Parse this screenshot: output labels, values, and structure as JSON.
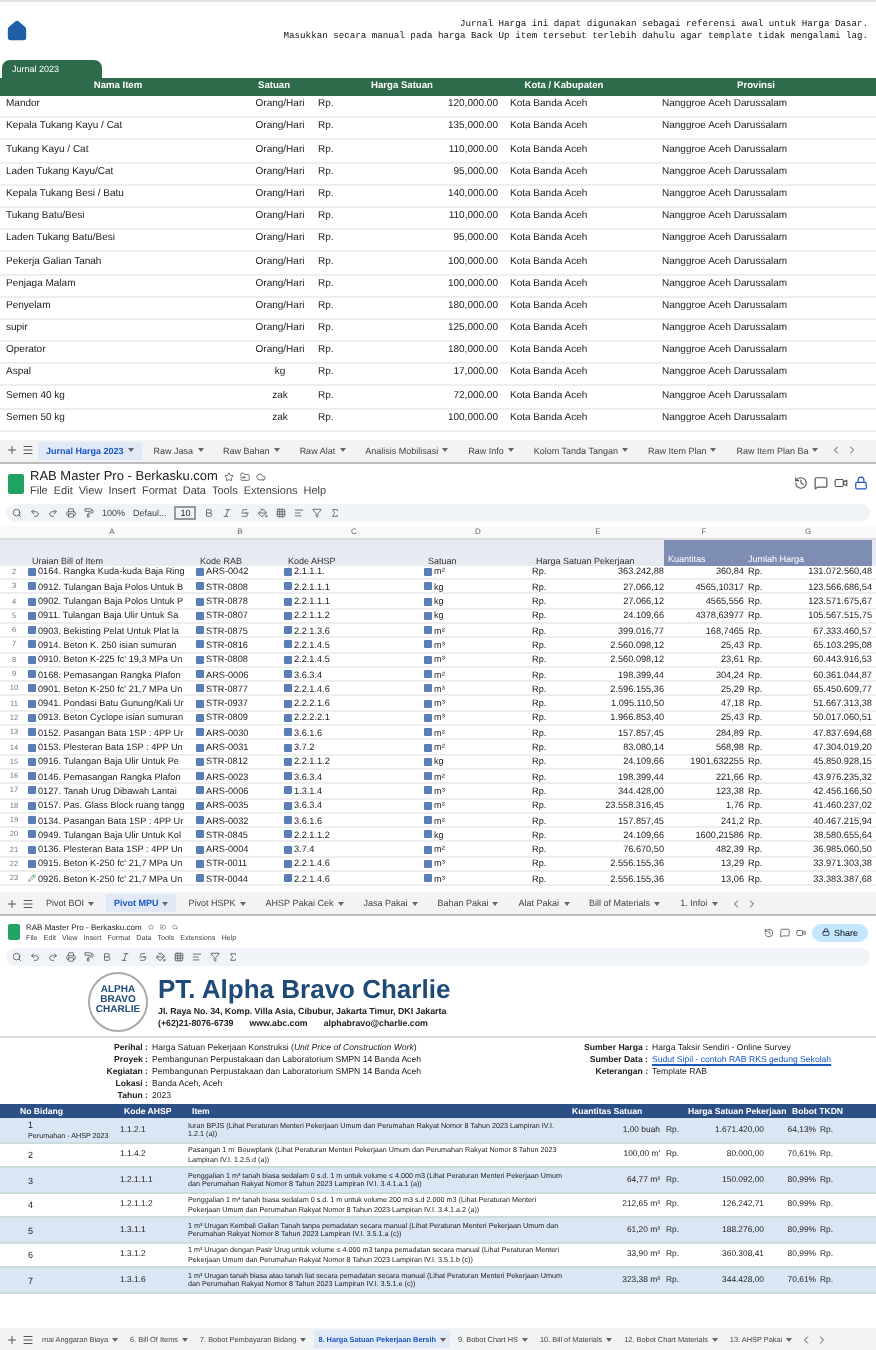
{
  "journal": {
    "notes": [
      "Jurnal Harga ini dapat digunakan sebagai referensi awal untuk Harga Dasar.",
      "Masukkan secara manual pada harga Back Up item tersebut terlebih dahulu agar template tidak mengalami lag."
    ],
    "filter_tab": "Jurnal 2023",
    "columns": [
      "Nama Item",
      "Satuan",
      "Harga Satuan",
      "Kota / Kabupaten",
      "Provinsi"
    ],
    "rows": [
      {
        "name": "Mandor",
        "unit": "Orang/Hari",
        "currency": "Rp.",
        "price": "120,000.00",
        "city": "Kota Banda Aceh",
        "province": "Nanggroe Aceh Darussalam"
      },
      {
        "name": "Kepala Tukang Kayu / Cat",
        "unit": "Orang/Hari",
        "currency": "Rp.",
        "price": "135,000.00",
        "city": "Kota Banda Aceh",
        "province": "Nanggroe Aceh Darussalam"
      },
      {
        "name": "Tukang Kayu / Cat",
        "unit": "Orang/Hari",
        "currency": "Rp.",
        "price": "110,000.00",
        "city": "Kota Banda Aceh",
        "province": "Nanggroe Aceh Darussalam"
      },
      {
        "name": "Laden Tukang Kayu/Cat",
        "unit": "Orang/Hari",
        "currency": "Rp.",
        "price": "95,000.00",
        "city": "Kota Banda Aceh",
        "province": "Nanggroe Aceh Darussalam"
      },
      {
        "name": "Kepala Tukang Besi / Batu",
        "unit": "Orang/Hari",
        "currency": "Rp.",
        "price": "140,000.00",
        "city": "Kota Banda Aceh",
        "province": "Nanggroe Aceh Darussalam"
      },
      {
        "name": "Tukang Batu/Besi",
        "unit": "Orang/Hari",
        "currency": "Rp.",
        "price": "110,000.00",
        "city": "Kota Banda Aceh",
        "province": "Nanggroe Aceh Darussalam"
      },
      {
        "name": "Laden Tukang Batu/Besi",
        "unit": "Orang/Hari",
        "currency": "Rp.",
        "price": "95,000.00",
        "city": "Kota Banda Aceh",
        "province": "Nanggroe Aceh Darussalam"
      },
      {
        "name": "Pekerja Galian Tanah",
        "unit": "Orang/Hari",
        "currency": "Rp.",
        "price": "100,000.00",
        "city": "Kota Banda Aceh",
        "province": "Nanggroe Aceh Darussalam"
      },
      {
        "name": "Penjaga Malam",
        "unit": "Orang/Hari",
        "currency": "Rp.",
        "price": "100,000.00",
        "city": "Kota Banda Aceh",
        "province": "Nanggroe Aceh Darussalam"
      },
      {
        "name": "Penyelam",
        "unit": "Orang/Hari",
        "currency": "Rp.",
        "price": "180,000.00",
        "city": "Kota Banda Aceh",
        "province": "Nanggroe Aceh Darussalam"
      },
      {
        "name": "supir",
        "unit": "Orang/Hari",
        "currency": "Rp.",
        "price": "125,000.00",
        "city": "Kota Banda Aceh",
        "province": "Nanggroe Aceh Darussalam"
      },
      {
        "name": "Operator",
        "unit": "Orang/Hari",
        "currency": "Rp.",
        "price": "180,000.00",
        "city": "Kota Banda Aceh",
        "province": "Nanggroe Aceh Darussalam"
      },
      {
        "name": "Aspal",
        "unit": "kg",
        "currency": "Rp.",
        "price": "17,000.00",
        "city": "Kota Banda Aceh",
        "province": "Nanggroe Aceh Darussalam"
      },
      {
        "name": "Semen 40 kg",
        "unit": "zak",
        "currency": "Rp.",
        "price": "72,000.00",
        "city": "Kota Banda Aceh",
        "province": "Nanggroe Aceh Darussalam"
      },
      {
        "name": "Semen 50 kg",
        "unit": "zak",
        "currency": "Rp.",
        "price": "100,000.00",
        "city": "Kota Banda Aceh",
        "province": "Nanggroe Aceh Darussalam"
      }
    ],
    "sheet_tabs": [
      {
        "label": "Jurnal Harga 2023",
        "selected": true
      },
      {
        "label": "Raw Jasa",
        "selected": false
      },
      {
        "label": "Raw Bahan",
        "selected": false
      },
      {
        "label": "Raw Alat",
        "selected": false
      },
      {
        "label": "Analisis Mobilisasi",
        "selected": false
      },
      {
        "label": "Raw Info",
        "selected": false
      },
      {
        "label": "Kolom Tanda Tangan",
        "selected": false
      },
      {
        "label": "Raw Item Plan",
        "selected": false
      },
      {
        "label": "Raw Item Plan Ba",
        "selected": false
      }
    ]
  },
  "bill": {
    "title": "RAB Master Pro - Berkasku.com",
    "menu": [
      "File",
      "Edit",
      "View",
      "Insert",
      "Format",
      "Data",
      "Tools",
      "Extensions",
      "Help"
    ],
    "zoom": "100%",
    "font": "Defaul...",
    "font_size": "10",
    "column_letters": [
      "A",
      "B",
      "C",
      "D",
      "E",
      "F",
      "G"
    ],
    "columns": [
      "Uraian Bill of Item",
      "Kode RAB",
      "Kode AHSP",
      "Satuan",
      "Harga Satuan Pekerjaan",
      "Kuantitas",
      "Jumlah Harga"
    ],
    "rows": [
      {
        "n": "2",
        "item": "0164. Rangka Kuda-kuda Baja Ring",
        "rab": "ARS-0042",
        "ahsp": "2.1.1.1.",
        "unit": "m²",
        "rp": "Rp.",
        "price": "363.242,88",
        "qty": "360,84",
        "rp2": "Rp.",
        "total": "131.072.560,48"
      },
      {
        "n": "3",
        "item": "0912. Tulangan Baja Polos Untuk B",
        "rab": "STR-0808",
        "ahsp": "2.2.1.1.1",
        "unit": "kg",
        "rp": "Rp.",
        "price": "27.066,12",
        "qty": "4565,10317",
        "rp2": "Rp.",
        "total": "123.566.686,54"
      },
      {
        "n": "4",
        "item": "0902. Tulangan Baja Polos Untuk P",
        "rab": "STR-0878",
        "ahsp": "2.2.1.1.1",
        "unit": "kg",
        "rp": "Rp.",
        "price": "27.066,12",
        "qty": "4565,556",
        "rp2": "Rp.",
        "total": "123.571.675,67"
      },
      {
        "n": "5",
        "item": "0911. Tulangan Baja Ulir Untuk Sa",
        "rab": "STR-0807",
        "ahsp": "2.2.1.1.2",
        "unit": "kg",
        "rp": "Rp.",
        "price": "24.109,66",
        "qty": "4378,63977",
        "rp2": "Rp.",
        "total": "105.567.515,75"
      },
      {
        "n": "6",
        "item": "0903. Bekisting Pelat Untuk Plat la",
        "rab": "STR-0875",
        "ahsp": "2.2.1.3.6",
        "unit": "m²",
        "rp": "Rp.",
        "price": "399.016,77",
        "qty": "168,7465",
        "rp2": "Rp.",
        "total": "67.333.460,57"
      },
      {
        "n": "7",
        "item": "0914. Beton K. 250 isian sumuran",
        "rab": "STR-0816",
        "ahsp": "2.2.1.4.5",
        "unit": "m³",
        "rp": "Rp.",
        "price": "2.560.098,12",
        "qty": "25,43",
        "rp2": "Rp.",
        "total": "65.103.295,08"
      },
      {
        "n": "8",
        "item": "0910. Beton K-225 fc' 19,3 MPa Un",
        "rab": "STR-0808",
        "ahsp": "2.2.1.4.5",
        "unit": "m³",
        "rp": "Rp.",
        "price": "2.560.098,12",
        "qty": "23,61",
        "rp2": "Rp.",
        "total": "60.443.916,53"
      },
      {
        "n": "9",
        "item": "0168. Pemasangan Rangka Plafon",
        "rab": "ARS-0006",
        "ahsp": "3.6.3.4",
        "unit": "m²",
        "rp": "Rp.",
        "price": "198.399,44",
        "qty": "304,24",
        "rp2": "Rp.",
        "total": "60.361.044,87"
      },
      {
        "n": "10",
        "item": "0901. Beton K-250 fc' 21,7 MPa Un",
        "rab": "STR-0877",
        "ahsp": "2.2.1.4.6",
        "unit": "m³",
        "rp": "Rp.",
        "price": "2.596.155,36",
        "qty": "25,29",
        "rp2": "Rp.",
        "total": "65.450.609,77"
      },
      {
        "n": "11",
        "item": "0941. Pondasi Batu Gunung/Kali Ur",
        "rab": "STR-0937",
        "ahsp": "2.2.2.1.6",
        "unit": "m³",
        "rp": "Rp.",
        "price": "1.095.110,50",
        "qty": "47,18",
        "rp2": "Rp.",
        "total": "51.667.313,38"
      },
      {
        "n": "12",
        "item": "0913. Beton Cyclope isian sumuran",
        "rab": "STR-0809",
        "ahsp": "2.2.2.2.1",
        "unit": "m³",
        "rp": "Rp.",
        "price": "1.966.853,40",
        "qty": "25,43",
        "rp2": "Rp.",
        "total": "50.017.060,51"
      },
      {
        "n": "13",
        "item": "0152. Pasangan Bata 1SP : 4PP Ur",
        "rab": "ARS-0030",
        "ahsp": "3.6.1.6",
        "unit": "m²",
        "rp": "Rp.",
        "price": "157.857,45",
        "qty": "284,89",
        "rp2": "Rp.",
        "total": "47.837.694,68"
      },
      {
        "n": "14",
        "item": "0153. Plesteran Bata 1SP : 4PP Un",
        "rab": "ARS-0031",
        "ahsp": "3.7.2",
        "unit": "m²",
        "rp": "Rp.",
        "price": "83.080,14",
        "qty": "568,98",
        "rp2": "Rp.",
        "total": "47.304.019,20"
      },
      {
        "n": "15",
        "item": "0916. Tulangan Baja Ulir Untuk Pe",
        "rab": "STR-0812",
        "ahsp": "2.2.1.1.2",
        "unit": "kg",
        "rp": "Rp.",
        "price": "24.109,66",
        "qty": "1901,632255",
        "rp2": "Rp.",
        "total": "45.850.928,15"
      },
      {
        "n": "16",
        "item": "0146. Pemasangan Rangka Plafon",
        "rab": "ARS-0023",
        "ahsp": "3.6.3.4",
        "unit": "m²",
        "rp": "Rp.",
        "price": "198.399,44",
        "qty": "221,66",
        "rp2": "Rp.",
        "total": "43.976.235,32"
      },
      {
        "n": "17",
        "item": "0127. Tanah Urug Dibawah Lantai",
        "rab": "ARS-0006",
        "ahsp": "1.3.1.4",
        "unit": "m³",
        "rp": "Rp.",
        "price": "344.428,00",
        "qty": "123,38",
        "rp2": "Rp.",
        "total": "42.456.166,50"
      },
      {
        "n": "18",
        "item": "0157. Pas. Glass Block ruang tangg",
        "rab": "ARS-0035",
        "ahsp": "3.6.3.4",
        "unit": "m²",
        "rp": "Rp.",
        "price": "23.558.316,45",
        "qty": "1,76",
        "rp2": "Rp.",
        "total": "41.460.237,02"
      },
      {
        "n": "19",
        "item": "0134. Pasangan Bata 1SP : 4PP Ur",
        "rab": "ARS-0032",
        "ahsp": "3.6.1.6",
        "unit": "m²",
        "rp": "Rp.",
        "price": "157.857,45",
        "qty": "241,2",
        "rp2": "Rp.",
        "total": "40.467.215,94"
      },
      {
        "n": "20",
        "item": "0949. Tulangan Baja Ulir Untuk Kol",
        "rab": "STR-0845",
        "ahsp": "2.2.1.1.2",
        "unit": "kg",
        "rp": "Rp.",
        "price": "24.109,66",
        "qty": "1600,21586",
        "rp2": "Rp.",
        "total": "38.580.655,64"
      },
      {
        "n": "21",
        "item": "0136. Plesteran Bata 1SP : 4PP Un",
        "rab": "ARS-0004",
        "ahsp": "3.7.4",
        "unit": "m²",
        "rp": "Rp.",
        "price": "76.670,50",
        "qty": "482,39",
        "rp2": "Rp.",
        "total": "36.985.060,50"
      },
      {
        "n": "22",
        "item": "0915. Beton K-250 fc' 21,7 MPa Un",
        "rab": "STR-0011",
        "ahsp": "2.2.1.4.6",
        "unit": "m³",
        "rp": "Rp.",
        "price": "2.556.155,36",
        "qty": "13,29",
        "rp2": "Rp.",
        "total": "33.971.303,38"
      },
      {
        "n": "23",
        "item": "0926. Beton K-250 fc' 21,7 MPa Un",
        "rab": "STR-0044",
        "ahsp": "2.2.1.4.6",
        "unit": "m³",
        "rp": "Rp.",
        "price": "2.556.155,36",
        "qty": "13,06",
        "rp2": "Rp.",
        "total": "33.383.387,68"
      }
    ],
    "sheet_tabs": [
      {
        "label": "Pivot BOI",
        "selected": false
      },
      {
        "label": "Pivot MPU",
        "selected": true
      },
      {
        "label": "Pivot HSPK",
        "selected": false
      },
      {
        "label": "AHSP Pakai Cek",
        "selected": false
      },
      {
        "label": "Jasa Pakai",
        "selected": false
      },
      {
        "label": "Bahan Pakai",
        "selected": false
      },
      {
        "label": "Alat Pakai",
        "selected": false
      },
      {
        "label": "Bill of Materials",
        "selected": false
      },
      {
        "label": "1. Infoi",
        "selected": false
      }
    ]
  },
  "price_sheet": {
    "title": "RAB Master Pro - Berkasku.com",
    "menu": [
      "File",
      "Edit",
      "View",
      "Insert",
      "Format",
      "Data",
      "Tools",
      "Extensions",
      "Help"
    ],
    "share": "Share",
    "logo_lines": [
      "ALPHA",
      "BRAVO",
      "CHARLIE"
    ],
    "company": "PT. Alpha Bravo Charlie",
    "address": "Jl. Raya No. 34, Komp. Villa Asia, Cibubur, Jakarta Timur, DKI Jakarta",
    "contacts": [
      "(+62)21-8076-6739",
      "www.abc.com",
      "alphabravo@charlie.com"
    ],
    "info_left": [
      {
        "label": "Perihal :",
        "value": "Harga Satuan Pekerjaan Konstruksi (*Unit Price of Construction Work*)"
      },
      {
        "label": "Proyek :",
        "value": "Pembangunan Perpustakaan dan Laboratorium SMPN 14 Banda Aceh"
      },
      {
        "label": "Kegiatan :",
        "value": "Pembangunan Perpustakaan dan Laboratorium SMPN 14 Banda Aceh"
      },
      {
        "label": "Lokasi :",
        "value": "Banda Aceh, Aceh"
      },
      {
        "label": "Tahun :",
        "value": "2023"
      }
    ],
    "info_right": [
      {
        "label": "Sumber Harga :",
        "value": "Harga Taksir Sendiri - Online Survey",
        "kind": "text"
      },
      {
        "label": "Sumber Data :",
        "value": "Sudut Sipil - contoh RAB RKS gedung Sekolah",
        "kind": "link"
      },
      {
        "label": "Keterangan :",
        "value": "Template RAB",
        "kind": "text"
      }
    ],
    "columns": [
      "No Bidang",
      "Kode AHSP",
      "Item",
      "Kuantitas Satuan",
      "Harga Satuan Pekerjaan",
      "Bobot TKDN"
    ],
    "rows": [
      {
        "no": "1",
        "sub": "Perumahan - AHSP 2023",
        "code": "1.1.2.1",
        "item": "Iuran BPJS (Lihat Peraturan Menteri Pekerjaan Umum dan Perumahan Rakyat Nomor 8 Tahun 2023 Lampiran IV.I. 1.2.1 (a))",
        "qty": "1,00 buah",
        "rp": "Rp.",
        "price": "1.671.420,00",
        "tkdn": "64,13%",
        "rp2": "Rp."
      },
      {
        "no": "2",
        "code": "1.1.4.2",
        "item": "Pasangan 1 m' Bouwplank (Lihat Peraturan Menteri Pekerjaan Umum dan Perumahan Rakyat Nomor 8 Tahun 2023 Lampiran IV.I. 1.2.5.d (a))",
        "qty": "100,00 m'",
        "rp": "Rp.",
        "price": "80.000,00",
        "tkdn": "70,61%",
        "rp2": "Rp."
      },
      {
        "no": "3",
        "code": "1.2.1.1.1",
        "item": "Penggalian 1 m³ tanah biasa sedalam 0 s.d. 1 m untuk volume ≤ 4.000 m3 (Lihat Peraturan Menteri Pekerjaan Umum dan Perumahan Rakyat Nomor 8 Tahun 2023 Lampiran IV.I. 3.4.1.a.1 (a))",
        "qty": "64,77 m³",
        "rp": "Rp.",
        "price": "150.092,00",
        "tkdn": "80,99%",
        "rp2": "Rp."
      },
      {
        "no": "4",
        "code": "1.2.1.1.2",
        "item": "Penggalian 1 m³ tanah biasa sedalam 0 s.d. 1 m untuk volume 200 m3 s.d 2.000 m3 (Lihat Peraturan Menteri Pekerjaan Umum dan Perumahan Rakyat Nomor 8 Tahun 2023 Lampiran IV.I. 3.4.1.a.2 (a))",
        "qty": "212,65 m³",
        "rp": "Rp.",
        "price": "126.242,71",
        "tkdn": "80,99%",
        "rp2": "Rp."
      },
      {
        "no": "5",
        "code": "1.3.1.1",
        "item": "1 m³ Urugan Kembali Galian Tanah tanpa pemadatan secara manual (Lihat Peraturan Menteri Pekerjaan Umum dan Perumahan Rakyat Nomor 8 Tahun 2023 Lampiran IV.I. 3.5.1.a (c))",
        "qty": "61,20 m³",
        "rp": "Rp.",
        "price": "188.276,00",
        "tkdn": "80,99%",
        "rp2": "Rp."
      },
      {
        "no": "6",
        "code": "1.3.1.2",
        "item": "1 m³ Urugan dengan Pasir Urug untuk volume ≤ 4.000 m3 tanpa pemadatan secara manual (Lihat Peraturan Menteri Pekerjaan Umum dan Perumahan Rakyat Nomor 8 Tahun 2023 Lampiran IV.I. 3.5.1.b (c))",
        "qty": "33,90 m³",
        "rp": "Rp.",
        "price": "360.308,41",
        "tkdn": "80,99%",
        "rp2": "Rp."
      },
      {
        "no": "7",
        "code": "1.3.1.6",
        "item": "1 m³ Urugan tanah biasa atau tanah liat secara pemadatan secara manual (Lihat Peraturan Menteri Pekerjaan Umum dan Perumahan Rakyat Nomor 8 Tahun 2023 Lampiran IV.I. 3.5.1.e (c))",
        "qty": "323,38 m³",
        "rp": "Rp.",
        "price": "344.428,00",
        "tkdn": "70,61%",
        "rp2": "Rp."
      }
    ],
    "sheet_tabs": [
      {
        "label": "mai Anggaran Biaya",
        "selected": false
      },
      {
        "label": "6. Bill Of Items",
        "selected": false
      },
      {
        "label": "7. Bobot Pembayaran Bidang",
        "selected": false
      },
      {
        "label": "8. Harga Satuan Pekerjaan Bersih",
        "selected": true
      },
      {
        "label": "9. Bobot Chart HS",
        "selected": false
      },
      {
        "label": "10. Bill of Materials",
        "selected": false
      },
      {
        "label": "12. Bobot Chart Materials",
        "selected": false
      },
      {
        "label": "13. AHSP Pakai",
        "selected": false
      }
    ]
  }
}
